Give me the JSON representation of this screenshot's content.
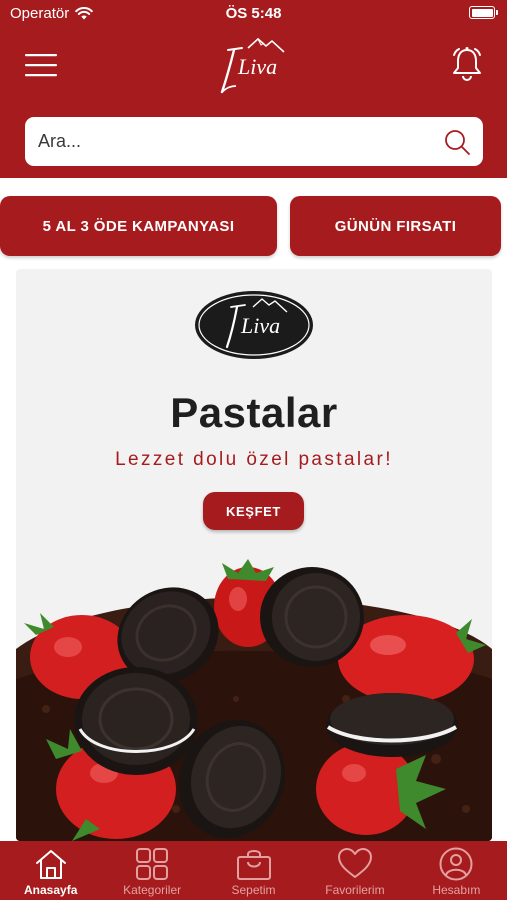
{
  "status_bar": {
    "carrier": "Operatör",
    "time": "ÖS 5:48"
  },
  "header": {
    "logo_text": "Liva"
  },
  "search": {
    "placeholder": "Ara..."
  },
  "campaigns": {
    "left_label": "5 AL 3 ÖDE KAMPANYASI",
    "right_label": "GÜNÜN FIRSATI"
  },
  "banner": {
    "logo_text": "Liva",
    "title": "Pastalar",
    "subtitle": "Lezzet dolu özel pastalar!",
    "button_label": "KEŞFET"
  },
  "tabbar": {
    "items": [
      {
        "label": "Anasayfa",
        "icon": "home-icon",
        "active": true
      },
      {
        "label": "Kategoriler",
        "icon": "grid-icon",
        "active": false
      },
      {
        "label": "Sepetim",
        "icon": "bag-icon",
        "active": false
      },
      {
        "label": "Favorilerim",
        "icon": "heart-icon",
        "active": false
      },
      {
        "label": "Hesabım",
        "icon": "user-icon",
        "active": false
      }
    ]
  },
  "colors": {
    "brand": "#a61c1e",
    "banner_bg": "#f2f2f2",
    "text_dark": "#1f1f1f"
  }
}
